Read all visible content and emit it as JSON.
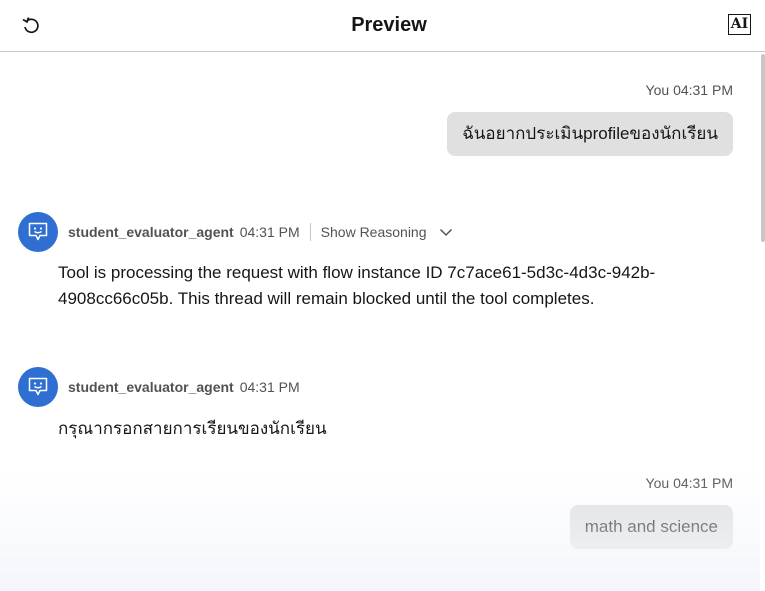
{
  "header": {
    "title": "Preview",
    "ai_badge": "AI"
  },
  "messages": [
    {
      "sender": "You",
      "time": "04:31 PM",
      "text": "ฉันอยากประเมินprofileของนักเรียน"
    },
    {
      "agent": "student_evaluator_agent",
      "time": "04:31 PM",
      "reasoning_label": "Show Reasoning",
      "text": "Tool is processing the request with flow instance ID 7c7ace61-5d3c-4d3c-942b-4908cc66c05b. This thread will remain blocked until the tool completes."
    },
    {
      "agent": "student_evaluator_agent",
      "time": "04:31 PM",
      "text": "กรุณากรอกสายการเรียนของนักเรียน"
    },
    {
      "sender": "You",
      "time": "04:31 PM",
      "text": "math and science"
    }
  ]
}
